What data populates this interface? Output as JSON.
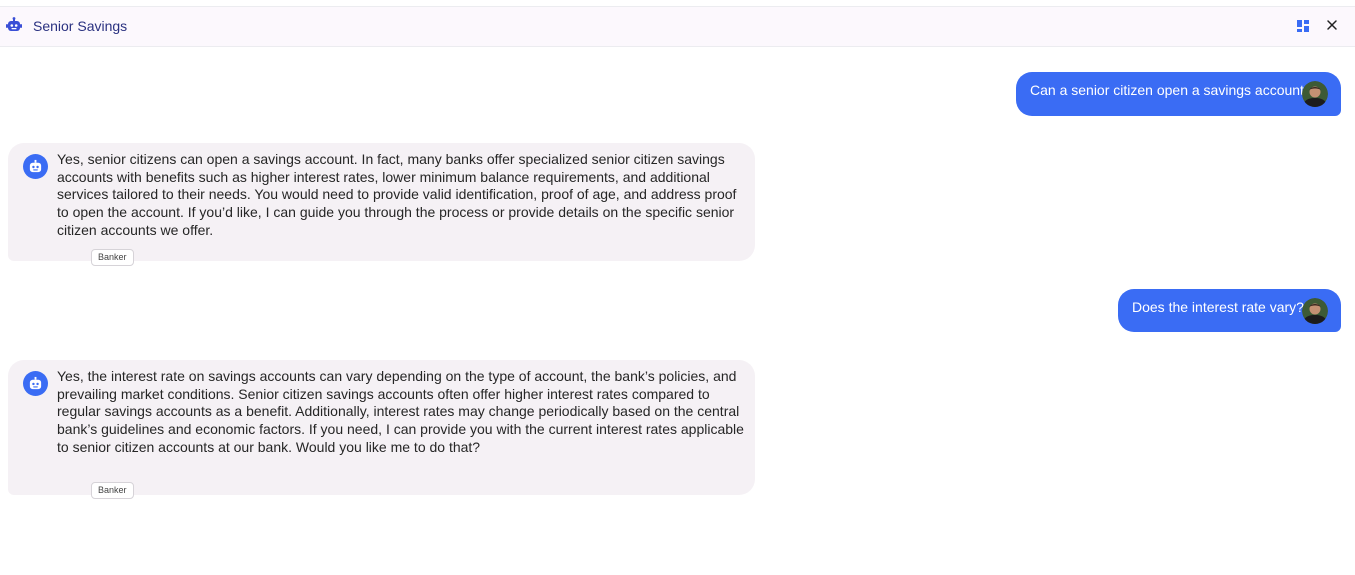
{
  "header": {
    "title": "Senior Savings",
    "bot_icon": "robot-icon",
    "layout_icon": "dashboard-layout-icon",
    "close_icon": "close-icon"
  },
  "colors": {
    "accent": "#3a6cf4",
    "header_bg": "#fcf8fd",
    "bot_bubble_bg": "#f5f1f5",
    "title_color": "#2a3180"
  },
  "messages": [
    {
      "role": "user",
      "text": "Can a senior citizen open a savings account?"
    },
    {
      "role": "bot",
      "text": "Yes, senior citizens can open a savings account. In fact, many banks offer specialized senior citizen savings accounts with benefits such as higher interest rates, lower minimum balance requirements, and additional services tailored to their needs. You would need to provide valid identification, proof of age, and address proof to open the account. If you’d like, I can guide you through the process or provide details on the specific senior citizen accounts we offer.",
      "badge": "Banker"
    },
    {
      "role": "user",
      "text": "Does the interest rate vary?"
    },
    {
      "role": "bot",
      "text": "Yes, the interest rate on savings accounts can vary depending on the type of account, the bank’s policies, and prevailing market conditions. Senior citizen savings accounts often offer higher interest rates compared to regular savings accounts as a benefit. Additionally, interest rates may change periodically based on the central bank’s guidelines and economic factors. If you need, I can provide you with the current interest rates applicable to senior citizen accounts at our bank. Would you like me to do that?",
      "badge": "Banker"
    }
  ]
}
